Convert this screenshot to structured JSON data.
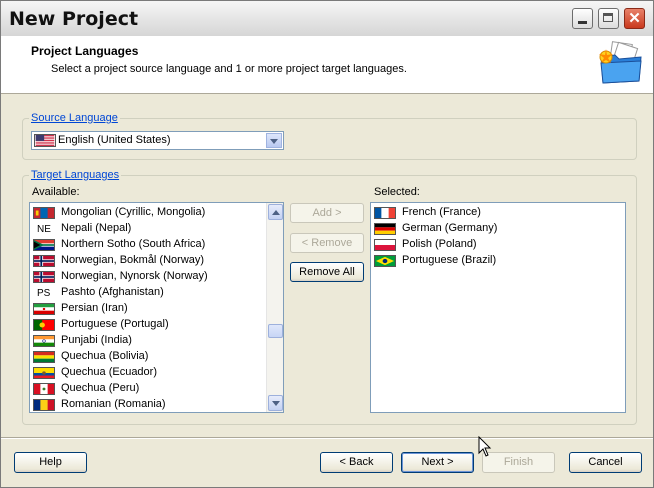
{
  "window": {
    "title": "New Project"
  },
  "header": {
    "title": "Project Languages",
    "subtitle": "Select a project source language and 1 or more project target languages."
  },
  "source": {
    "legend": "Source Language",
    "selected": "English (United States)"
  },
  "target": {
    "legend": "Target Languages",
    "available_label": "Available:",
    "selected_label": "Selected:",
    "available": [
      {
        "label": "Mongolian (Cyrillic, Mongolia)",
        "flag": "mongolia"
      },
      {
        "label": "Nepali (Nepal)",
        "flag": "code",
        "code": "NE"
      },
      {
        "label": "Northern Sotho (South Africa)",
        "flag": "south-africa"
      },
      {
        "label": "Norwegian, Bokmål (Norway)",
        "flag": "norway"
      },
      {
        "label": "Norwegian, Nynorsk (Norway)",
        "flag": "norway"
      },
      {
        "label": "Pashto (Afghanistan)",
        "flag": "code",
        "code": "PS"
      },
      {
        "label": "Persian (Iran)",
        "flag": "iran"
      },
      {
        "label": "Portuguese (Portugal)",
        "flag": "portugal"
      },
      {
        "label": "Punjabi (India)",
        "flag": "india"
      },
      {
        "label": "Quechua (Bolivia)",
        "flag": "bolivia"
      },
      {
        "label": "Quechua (Ecuador)",
        "flag": "ecuador"
      },
      {
        "label": "Quechua (Peru)",
        "flag": "peru"
      },
      {
        "label": "Romanian (Romania)",
        "flag": "romania"
      }
    ],
    "selected": [
      {
        "label": "French (France)",
        "flag": "france"
      },
      {
        "label": "German (Germany)",
        "flag": "germany"
      },
      {
        "label": "Polish (Poland)",
        "flag": "poland"
      },
      {
        "label": "Portuguese (Brazil)",
        "flag": "brazil"
      }
    ]
  },
  "buttons": {
    "add": "Add >",
    "remove": "< Remove",
    "remove_all": "Remove All",
    "help": "Help",
    "back": "< Back",
    "next": "Next >",
    "finish": "Finish",
    "cancel": "Cancel"
  },
  "colors": {
    "accent": "#0046d5",
    "face": "#ece9d8",
    "border": "#7f9db9"
  }
}
